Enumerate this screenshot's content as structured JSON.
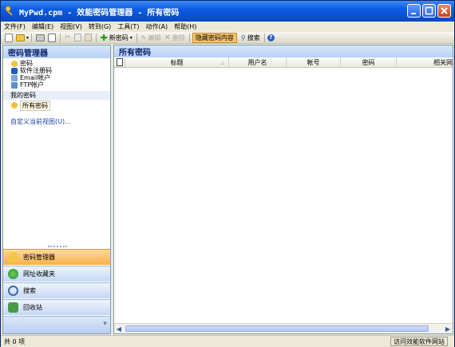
{
  "window": {
    "title": "MyPwd.cpm - 效能密码管理器 - 所有密码"
  },
  "menu": [
    "文件(F)",
    "编辑(E)",
    "视图(V)",
    "转到(G)",
    "工具(T)",
    "动作(A)",
    "帮助(H)"
  ],
  "toolbar": {
    "new_password": "新密码",
    "edit": "编辑",
    "delete": "删除",
    "hide_content": "隐藏密码内容",
    "search": "搜索"
  },
  "sidebar": {
    "header": "密码管理器",
    "items": [
      "密码",
      "软件注册码",
      "Email帐户",
      "FTP帐户"
    ],
    "section_label": "我的密码",
    "selected_item": "所有密码",
    "customize_link": "自定义当前视图(U)..."
  },
  "nav": {
    "buttons": [
      "密码管理器",
      "网址收藏夹",
      "搜索",
      "回收站"
    ],
    "more": "»"
  },
  "main": {
    "header": "所有密码",
    "columns": [
      "",
      "标题",
      "用户名",
      "帐号",
      "密码",
      "相关网"
    ]
  },
  "status": {
    "count": "共 0 项",
    "link": "访问效能软件网站"
  }
}
